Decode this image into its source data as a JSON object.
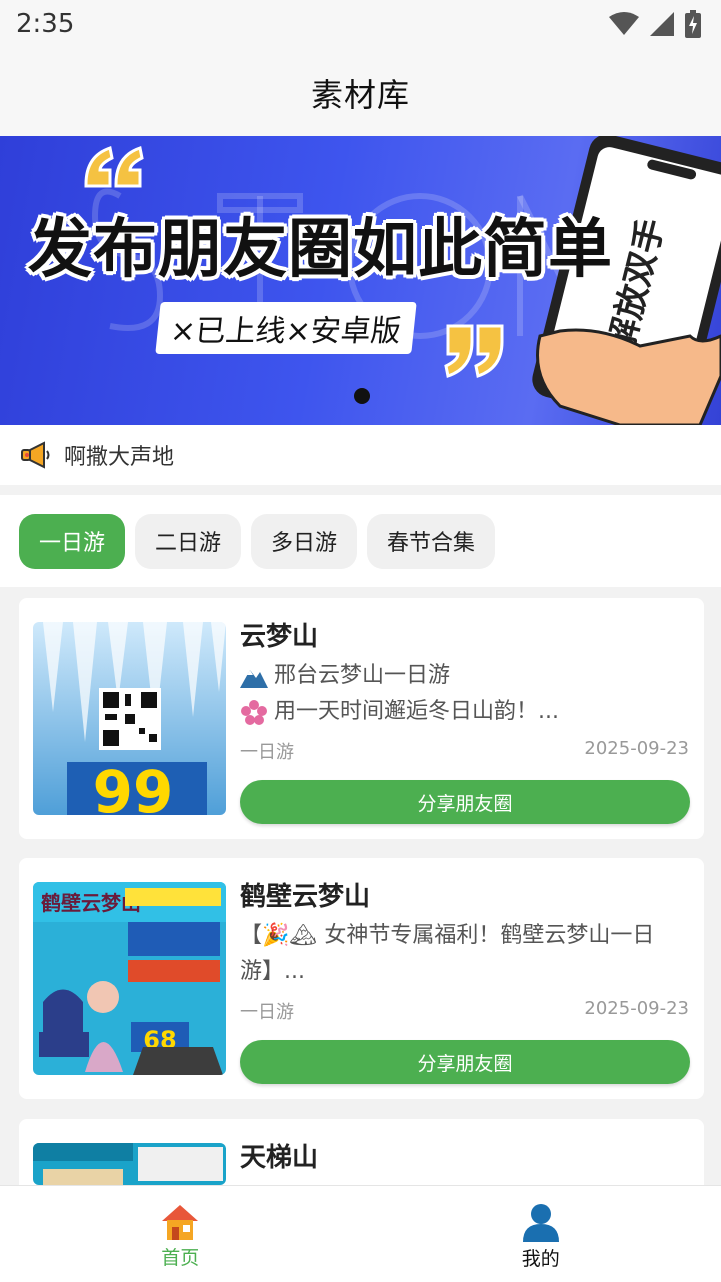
{
  "status_bar": {
    "time": "2:35",
    "icons": [
      "wifi-icon",
      "cell-signal-icon",
      "battery-charging-icon"
    ]
  },
  "header": {
    "title": "素材库"
  },
  "banner": {
    "headline": "发布朋友圈如此简单",
    "subline": "×已上线×安卓版",
    "phone_text": "解放双手",
    "colors": {
      "background": "#3e55ee",
      "quote": "#f5c242"
    }
  },
  "notice": {
    "icon": "megaphone-icon",
    "text": "啊撒大声地"
  },
  "tabs": [
    {
      "label": "一日游",
      "active": true
    },
    {
      "label": "二日游",
      "active": false
    },
    {
      "label": "多日游",
      "active": false
    },
    {
      "label": "春节合集",
      "active": false
    }
  ],
  "cards": [
    {
      "title": "云梦山",
      "desc_line1": "邢台云梦山一日游",
      "desc_line2": "用一天时间邂逅冬日山韵！...",
      "category": "一日游",
      "date": "2025-09-23",
      "share_label": "分享朋友圈",
      "poster_price": "99"
    },
    {
      "title": "鹤壁云梦山",
      "desc_line1": "【🎉🏔 女神节专属福利！鹤壁云梦山一日",
      "desc_line2": "游】...",
      "category": "一日游",
      "date": "2025-09-23",
      "share_label": "分享朋友圈",
      "poster_title": "鹤壁云梦山",
      "poster_price": "68"
    },
    {
      "title": "天梯山"
    }
  ],
  "bottom_nav": [
    {
      "label": "首页",
      "icon": "home-icon",
      "active": true
    },
    {
      "label": "我的",
      "icon": "user-icon",
      "active": false
    }
  ],
  "colors": {
    "accent": "#4caf50",
    "tab_inactive": "#f0f0f0"
  }
}
